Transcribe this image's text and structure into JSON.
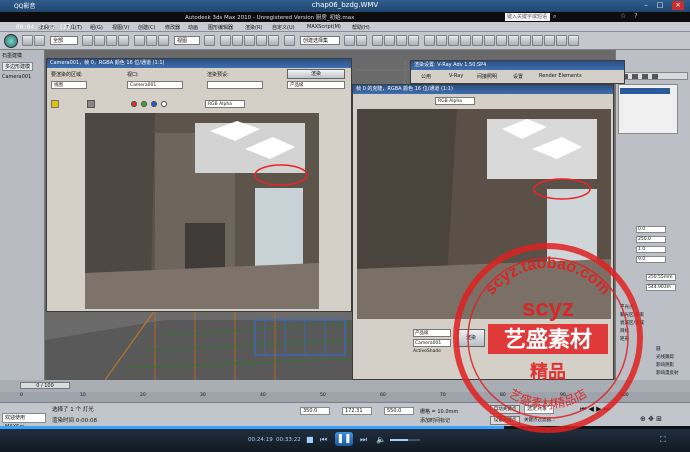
{
  "player": {
    "app_name": "QQ影音",
    "file_title": "chap06_bzdg.WMV",
    "time_current": "00:24:19",
    "time_total": "00:33:22",
    "colors": {
      "accent": "#3aa0ff"
    },
    "progress": 0.73,
    "volume": 0.6,
    "overlay_time": "00:04:07:22 (ZZ)"
  },
  "max": {
    "title": "Autodesk 3ds Max 2010 - Unregistered Version  厨房_初始.max",
    "help_search": "键入关键字或短语",
    "menus": [
      "编辑(E)",
      "工具(T)",
      "组(G)",
      "视图(V)",
      "创建(C)",
      "修改器",
      "动画",
      "图形编辑器",
      "渲染(R)",
      "自定义(U)",
      "MAXScript(M)",
      "帮助(H)"
    ],
    "toolbar_select": "全部",
    "toolbar_view": "视图",
    "selection_set": "创建选择集"
  },
  "left_panel": {
    "title": "石墨建模",
    "tab": "多边形建模",
    "object": "Camera001"
  },
  "render_left": {
    "title": "Camera001，帧 0，RGBA 颜色 16 位/通道 (1:1)",
    "area_label": "要渲染的区域:",
    "area_value": "视图",
    "viewport_label": "视口:",
    "viewport_value": "Camera001",
    "preset_label": "渲染预设:",
    "preset_value": "",
    "render_button": "渲染",
    "production_value": "产品级",
    "channel_value": "RGB Alpha"
  },
  "render_right": {
    "title": "V-Ray frame buffer - [100% of 1000 x 750]",
    "subtitle": "帧 0 的克隆，RGBA 颜色 16 位/通道 (1:1)",
    "channel_value": "RGB Alpha"
  },
  "vray_dialog": {
    "title": "渲染设置: V-Ray Adv 1.50.SP4",
    "tabs": [
      "公用",
      "V-Ray",
      "间接照明",
      "设置",
      "Render Elements"
    ]
  },
  "right_panel": {
    "fields": [
      "0.0",
      "250.0",
      "1.0",
      "9.0"
    ],
    "values": [
      "250.55mm",
      "544.903m"
    ],
    "items": [
      "平光点",
      "聚光区/光束",
      "衰减区/区域",
      "目标",
      "矩形",
      "圆",
      "光线跟踪",
      "影响阴影",
      "影响漫反射",
      "影响高光反射",
      "影响反射"
    ]
  },
  "lower_panel": {
    "items": [
      "产品级",
      "Camera001",
      "ActiveShade"
    ],
    "render_button": "渲染"
  },
  "timeline": {
    "frame": "0 / 100",
    "ticks": [
      "0",
      "10",
      "20",
      "30",
      "40",
      "50",
      "60",
      "70",
      "80",
      "90",
      "100"
    ]
  },
  "status": {
    "selection": "选择了 1 个 灯光",
    "render_time": "渲染时间 0:00:08",
    "welcome": "欢迎使用 MAXScr",
    "x_value": "350.0",
    "y_value": "172.31",
    "z_value": "550.0",
    "grid": "栅格 = 10.0mm",
    "auto_key": "自动关键点",
    "set_key": "设置关键点",
    "selected": "选定对象",
    "add_time_tag": "添加时间标记",
    "key_filter": "关键点过滤器..."
  },
  "watermark": {
    "top_text": "scyz.taobao.com",
    "middle_text": "scyz",
    "name": "艺盛素材",
    "quality": "精品",
    "bottom_text": "艺盛素材精品店"
  }
}
